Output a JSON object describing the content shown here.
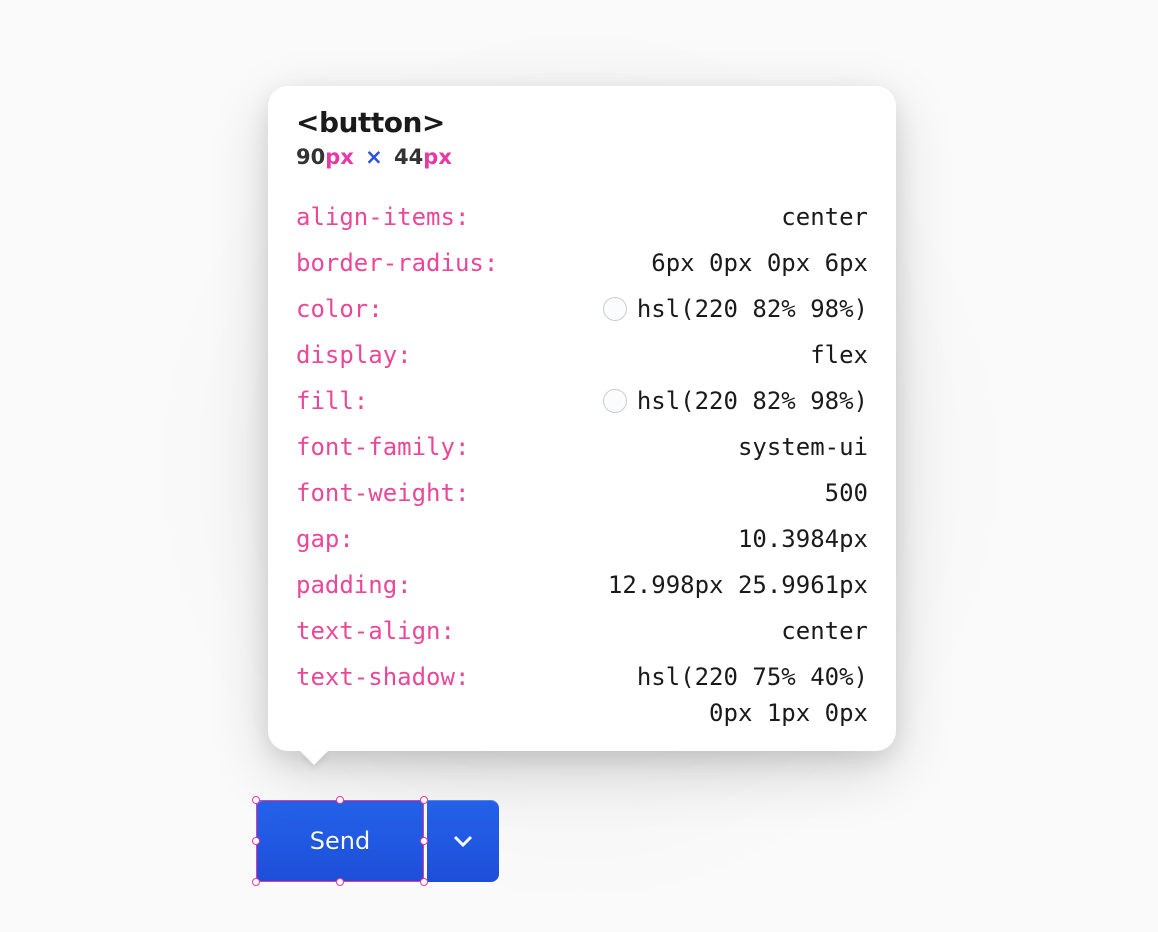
{
  "inspector": {
    "element_tag": "<button>",
    "dimensions": {
      "width": "90",
      "width_unit": "px",
      "separator": "×",
      "height": "44",
      "height_unit": "px"
    },
    "properties": [
      {
        "name": "align-items:",
        "value": "center",
        "has_swatch": false
      },
      {
        "name": "border-radius:",
        "value": "6px 0px 0px 6px",
        "has_swatch": false
      },
      {
        "name": "color:",
        "value": "hsl(220 82% 98%)",
        "has_swatch": true
      },
      {
        "name": "display:",
        "value": "flex",
        "has_swatch": false
      },
      {
        "name": "fill:",
        "value": "hsl(220 82% 98%)",
        "has_swatch": true
      },
      {
        "name": "font-family:",
        "value": "system-ui",
        "has_swatch": false
      },
      {
        "name": "font-weight:",
        "value": "500",
        "has_swatch": false
      },
      {
        "name": "gap:",
        "value": "10.3984px",
        "has_swatch": false
      },
      {
        "name": "padding:",
        "value": "12.998px 25.9961px",
        "has_swatch": false
      },
      {
        "name": "text-align:",
        "value": "center",
        "has_swatch": false
      },
      {
        "name": "text-shadow:",
        "value": "hsl(220 75% 40%)",
        "value_line2": "0px 1px 0px",
        "has_swatch": false
      }
    ]
  },
  "button": {
    "send_label": "Send"
  }
}
